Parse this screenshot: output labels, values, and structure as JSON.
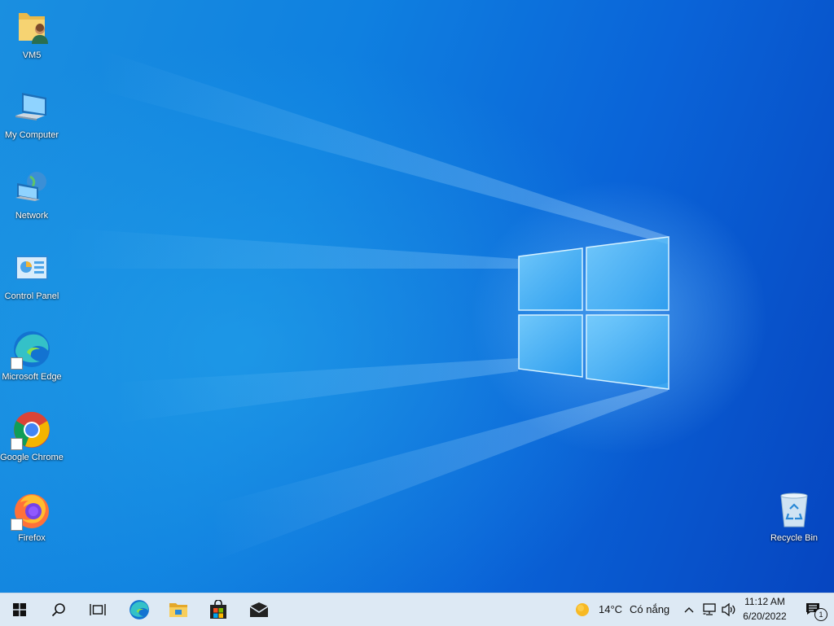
{
  "desktop": {
    "icons": [
      {
        "label": "VM5",
        "icon": "user-folder-icon"
      },
      {
        "label": "My Computer",
        "icon": "computer-icon"
      },
      {
        "label": "Network",
        "icon": "network-icon"
      },
      {
        "label": "Control Panel",
        "icon": "control-panel-icon"
      },
      {
        "label": "Microsoft Edge",
        "icon": "edge-icon"
      },
      {
        "label": "Google Chrome",
        "icon": "chrome-icon"
      },
      {
        "label": "Firefox",
        "icon": "firefox-icon"
      },
      {
        "label": "Recycle Bin",
        "icon": "recycle-bin-icon"
      }
    ]
  },
  "taskbar": {
    "buttons": [
      "start-icon",
      "search-icon",
      "task-view-icon",
      "edge-icon",
      "file-explorer-icon",
      "store-icon",
      "mail-icon"
    ],
    "weather": {
      "temperature": "14°C",
      "condition": "Có nắng",
      "icon": "sun-icon"
    },
    "tray_icons": [
      "chevron-up-icon",
      "network-icon",
      "volume-icon"
    ],
    "clock": {
      "time": "11:12 AM",
      "date": "6/20/2022"
    },
    "notifications": {
      "count": "1",
      "icon": "action-center-icon"
    }
  },
  "colors": {
    "taskbar_bg": "#dde9f4",
    "desktop_blue": "#0a64d8"
  }
}
